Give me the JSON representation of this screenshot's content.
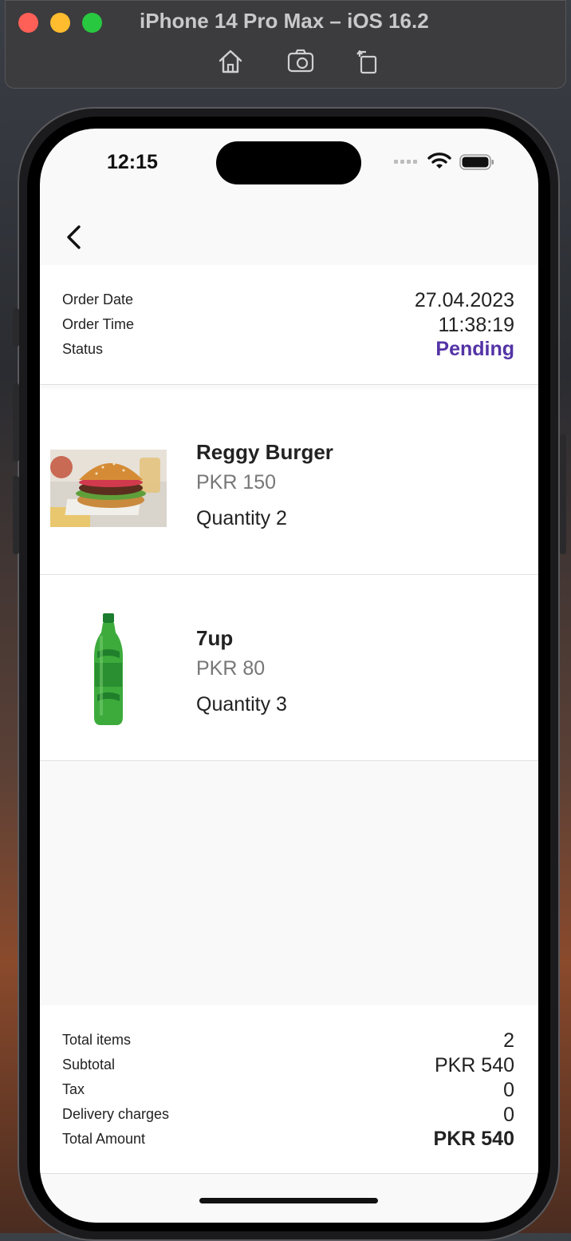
{
  "window": {
    "title": "iPhone 14 Pro Max – iOS 16.2",
    "toolbar_icons": [
      "home-icon",
      "screenshot-icon",
      "rotate-icon"
    ]
  },
  "status_bar": {
    "time": "12:15",
    "icons": [
      "signal-icon",
      "wifi-icon",
      "battery-icon"
    ]
  },
  "nav": {
    "back_icon": "chevron-left-icon"
  },
  "order": {
    "date_label": "Order Date",
    "date_value": "27.04.2023",
    "time_label": "Order Time",
    "time_value": "11:38:19",
    "status_label": "Status",
    "status_value": "Pending",
    "status_color": "#5433a6"
  },
  "items": [
    {
      "name": "Reggy Burger",
      "price": "PKR 150",
      "quantity": "Quantity 2",
      "image": "burger-image"
    },
    {
      "name": "7up",
      "price": "PKR 80",
      "quantity": "Quantity 3",
      "image": "soda-bottle-image"
    }
  ],
  "summary": {
    "total_items_label": "Total items",
    "total_items_value": "2",
    "subtotal_label": "Subtotal",
    "subtotal_value": "PKR 540",
    "tax_label": "Tax",
    "tax_value": "0",
    "delivery_label": "Delivery charges",
    "delivery_value": "0",
    "total_label": "Total Amount",
    "total_value": "PKR 540"
  }
}
